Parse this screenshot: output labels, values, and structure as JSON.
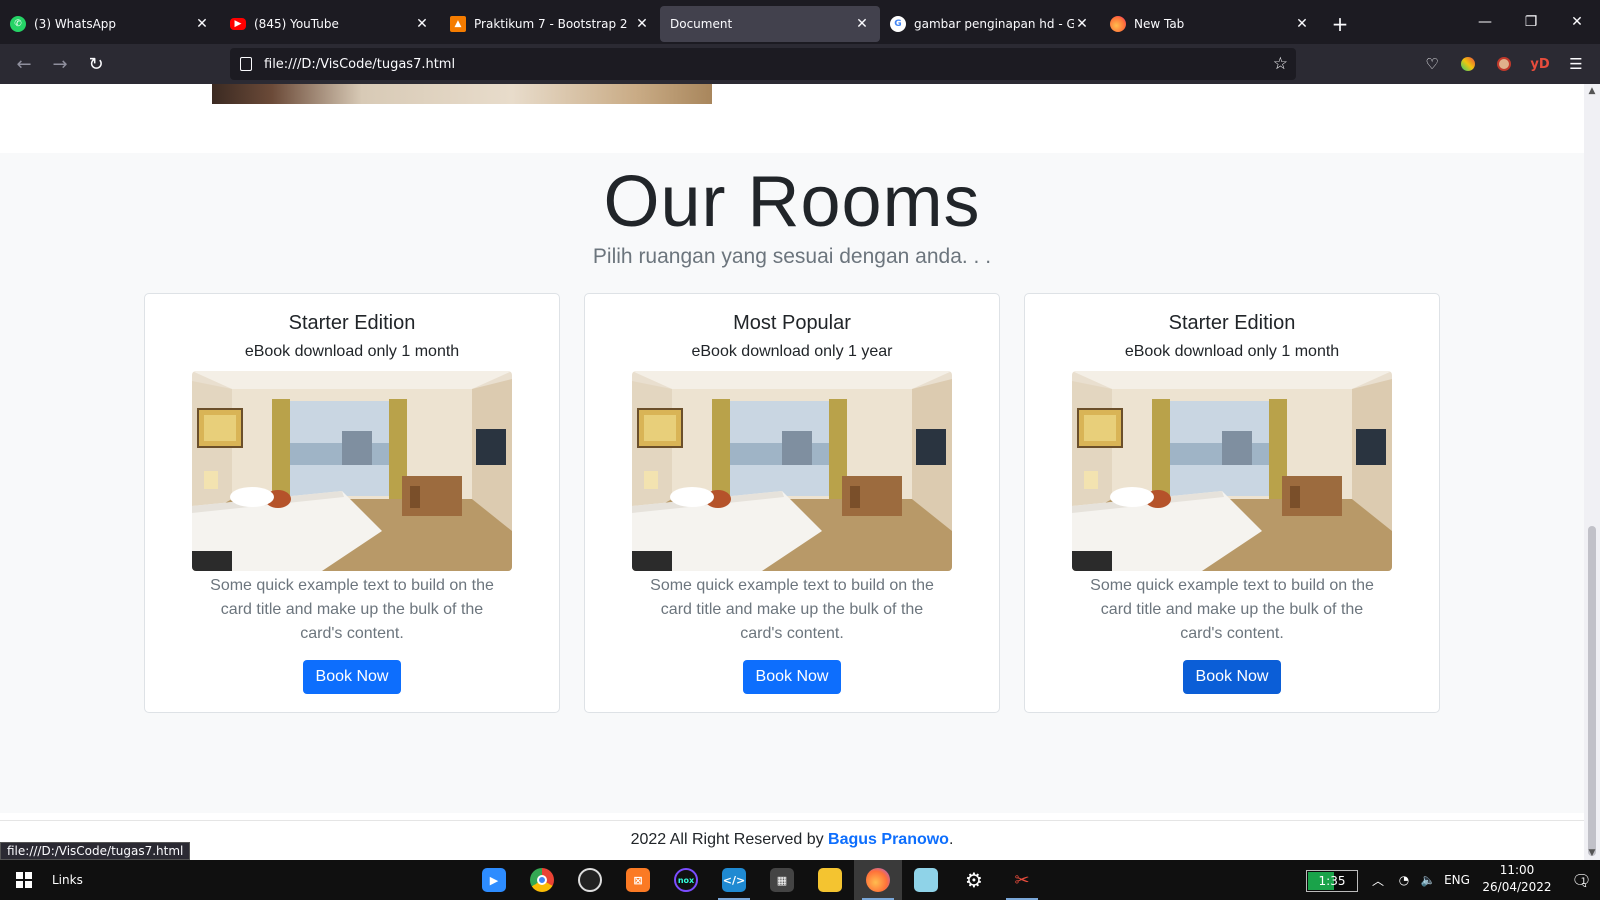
{
  "browser": {
    "tabs": [
      {
        "label": "(3) WhatsApp",
        "icon": "whatsapp-icon",
        "color": "#25d366"
      },
      {
        "label": "(845) YouTube",
        "icon": "youtube-icon",
        "color": "#ff0000"
      },
      {
        "label": "Praktikum 7 - Bootstrap 2",
        "icon": "classroom-icon",
        "color": "#f57c00"
      },
      {
        "label": "Document",
        "icon": "",
        "color": ""
      },
      {
        "label": "gambar penginapan hd - Googl",
        "icon": "google-icon",
        "color": "#4285f4"
      },
      {
        "label": "New Tab",
        "icon": "firefox-icon",
        "color": "#ff7139"
      }
    ],
    "url": "file:///D:/VisCode/tugas7.html"
  },
  "page": {
    "heading": "Our Rooms",
    "lead": "Pilih ruangan yang sesuai dengan anda. . .",
    "cards": [
      {
        "title": "Starter Edition",
        "subtitle": "eBook download only 1 month",
        "text": "Some quick example text to build on the card title and make up the bulk of the card's content.",
        "button": "Book Now"
      },
      {
        "title": "Most Popular",
        "subtitle": "eBook download only 1 year",
        "text": "Some quick example text to build on the card title and make up the bulk of the card's content.",
        "button": "Book Now"
      },
      {
        "title": "Starter Edition",
        "subtitle": "eBook download only 1 month",
        "text": "Some quick example text to build on the card title and make up the bulk of the card's content.",
        "button": "Book Now"
      }
    ],
    "footer": {
      "prefix": "2022 All Right Reserved by ",
      "brand": "Bagus Pranowo",
      "suffix": "."
    },
    "accent": "#0d6efd"
  },
  "status_url": "file:///D:/VisCode/tugas7.html",
  "taskbar": {
    "links_label": "Links",
    "battery": "1:35",
    "language": "ENG",
    "time": "11:00",
    "date": "26/04/2022",
    "notification_count": "1"
  }
}
